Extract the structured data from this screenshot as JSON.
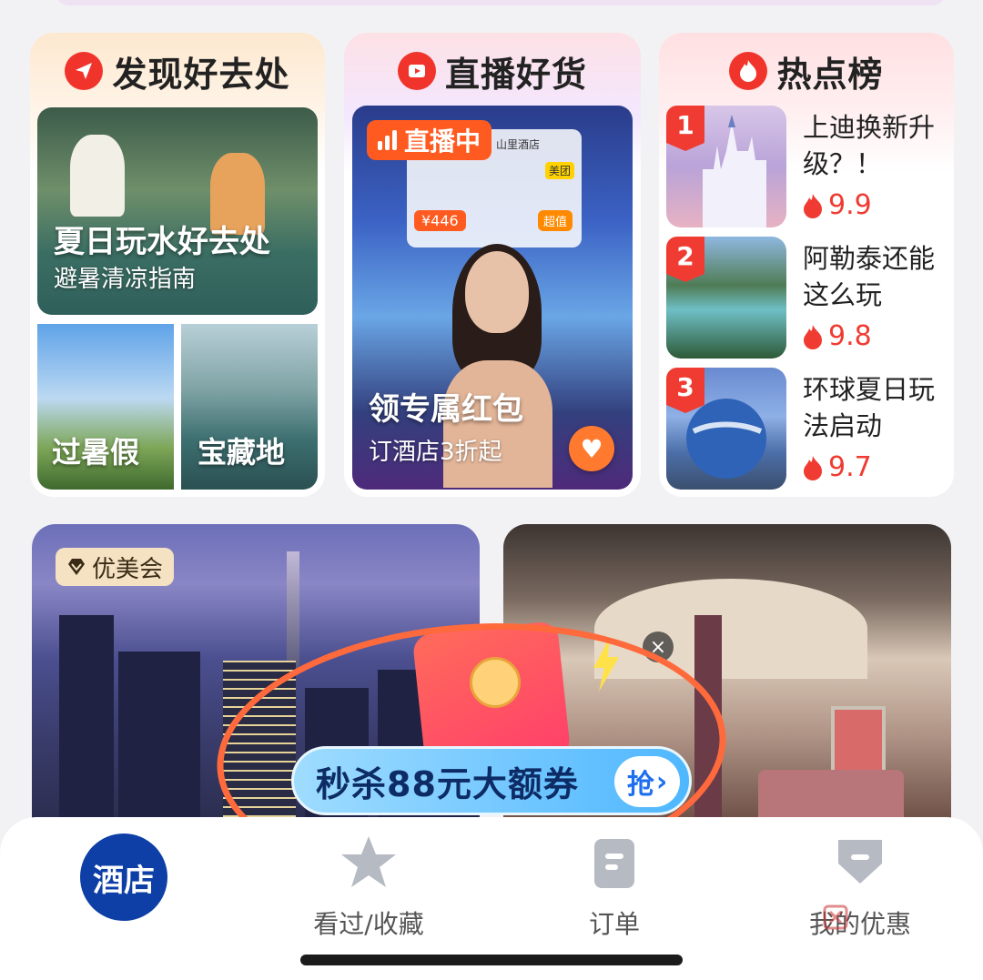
{
  "discover": {
    "title": "发现好去处",
    "main_tile": {
      "label": "夏日玩水好去处",
      "sub": "避暑清凉指南"
    },
    "small_tiles": [
      {
        "label": "过暑假"
      },
      {
        "label": "宝藏地"
      }
    ]
  },
  "live": {
    "title": "直播好货",
    "badge": "直播中",
    "board": {
      "hotel": "山里酒店",
      "brand": "美团",
      "price": "¥446",
      "deal": "超值"
    },
    "tile": {
      "label": "领专属红包",
      "sub": "订酒店3折起"
    }
  },
  "hot": {
    "title": "热点榜",
    "items": [
      {
        "rank": "1",
        "title": "上迪换新升级？！",
        "score": "9.9"
      },
      {
        "rank": "2",
        "title": "阿勒泰还能这么玩",
        "score": "9.8"
      },
      {
        "rank": "3",
        "title": "环球夏日玩法启动",
        "score": "9.7"
      }
    ]
  },
  "banner": {
    "vip_tag": "优美会"
  },
  "popup": {
    "deal_text": "秒杀88元大额券",
    "grab_label": "抢",
    "close_label": "×"
  },
  "tabbar": {
    "hotel": "酒店",
    "favorites": "看过/收藏",
    "orders": "订单",
    "promos": "我的优惠"
  },
  "colors": {
    "accent_red": "#ef3b31",
    "live_orange": "#ff5a1f",
    "tab_active_blue": "#0d3fa6",
    "annotation_orange": "#ff6a3d"
  },
  "icons": {
    "discover": "send-icon",
    "live": "play-icon",
    "hot": "flame-icon",
    "vip": "diamond-icon"
  }
}
